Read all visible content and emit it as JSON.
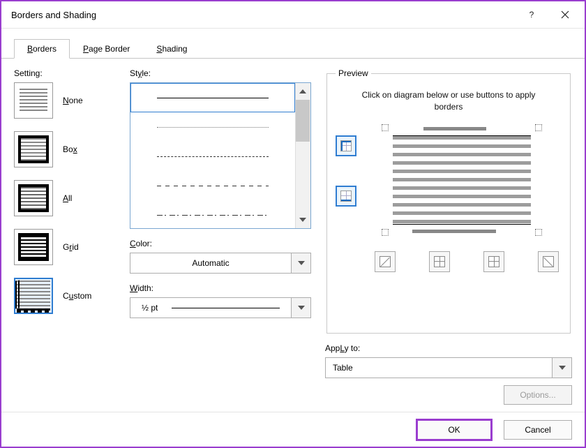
{
  "dialog": {
    "title": "Borders and Shading"
  },
  "tabs": {
    "borders_label": "Borders",
    "pageborder_label": "Page Border",
    "shading_label": "Shading",
    "borders_hotkey": "B",
    "pageborder_hotkey": "P",
    "shading_hotkey": "S"
  },
  "setting": {
    "label": "Setting:",
    "items": [
      {
        "label": "None",
        "hotkey": "N"
      },
      {
        "label": "Box",
        "hotkey": "x"
      },
      {
        "label": "All",
        "hotkey": "A"
      },
      {
        "label": "Grid",
        "hotkey": "r"
      },
      {
        "label": "Custom",
        "hotkey": "u"
      }
    ],
    "selected_index": 4
  },
  "style_label": "Style:",
  "style_hotkey": "y",
  "color": {
    "label": "Color:",
    "hotkey": "C",
    "value": "Automatic"
  },
  "width": {
    "label": "Width:",
    "hotkey": "W",
    "value": "½ pt"
  },
  "preview": {
    "legend": "Preview",
    "help": "Click on diagram below or use buttons to apply borders"
  },
  "apply": {
    "label": "Apply to:",
    "hotkey": "L",
    "value": "Table"
  },
  "options_label": "Options...",
  "footer": {
    "ok": "OK",
    "cancel": "Cancel"
  }
}
